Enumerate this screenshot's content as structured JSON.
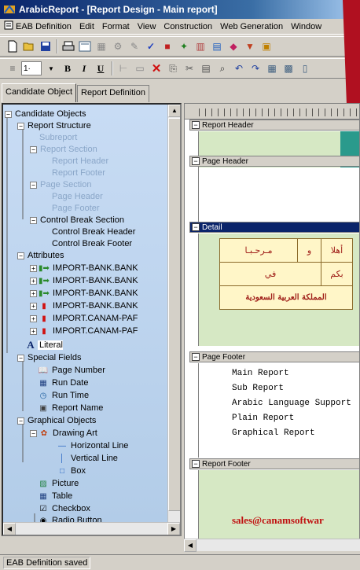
{
  "window": {
    "title": "ArabicReport - [Report Design - Main report]",
    "icon": "app-icon"
  },
  "menu": {
    "items": [
      "EAB Definition",
      "Edit",
      "Format",
      "View",
      "Construction",
      "Web Generation",
      "Window"
    ]
  },
  "toolbar": {
    "font_size": "1·",
    "bold": "B",
    "italic": "I",
    "underline": "U"
  },
  "tabs": {
    "candidate": "Candidate Object",
    "report_def": "Report Definition"
  },
  "tree": {
    "root": "Candidate Objects",
    "report_structure": "Report Structure",
    "subreport": "Subreport",
    "report_section": "Report Section",
    "report_header": "Report Header",
    "report_footer": "Report Footer",
    "page_section": "Page Section",
    "page_header": "Page Header",
    "page_footer": "Page Footer",
    "control_break_section": "Control Break Section",
    "control_break_header": "Control Break Header",
    "control_break_footer": "Control Break Footer",
    "attributes": "Attributes",
    "attr_items": [
      "IMPORT-BANK.BANK",
      "IMPORT-BANK.BANK",
      "IMPORT-BANK.BANK",
      "IMPORT-BANK.BANK",
      "IMPORT.CANAM-PAF",
      "IMPORT.CANAM-PAF"
    ],
    "literal": "Literal",
    "special_fields": "Special Fields",
    "page_number": "Page Number",
    "run_date": "Run Date",
    "run_time": "Run Time",
    "report_name": "Report Name",
    "graphical_objects": "Graphical Objects",
    "drawing_art": "Drawing Art",
    "horizontal_line": "Horizontal Line",
    "vertical_line": "Vertical Line",
    "box": "Box",
    "picture": "Picture",
    "table": "Table",
    "checkbox": "Checkbox",
    "radio_button": "Radio Button"
  },
  "design": {
    "report_header": "Report Header",
    "page_header": "Page Header",
    "detail": "Detail",
    "page_footer": "Page Footer",
    "report_footer": "Report Footer",
    "arabic": {
      "marhaba": "مـرحـبـا",
      "wa": "و",
      "ahlan": "أهلا",
      "fi": "في",
      "bikum": "بكم",
      "kingdom": "المملكة العربية السعودية"
    },
    "page_footer_lines": [
      "Main Report",
      "Sub Report",
      "Arabic Language Support",
      "Plain Report",
      "Graphical Report"
    ],
    "email": "sales@canamsoftwar"
  },
  "status": {
    "text": "EAB Definition saved"
  },
  "colors": {
    "tree_bg": "#c8dcf4",
    "band_green": "#d6e8c4",
    "accent_red": "#b01020",
    "title_blue": "#0a246a"
  }
}
